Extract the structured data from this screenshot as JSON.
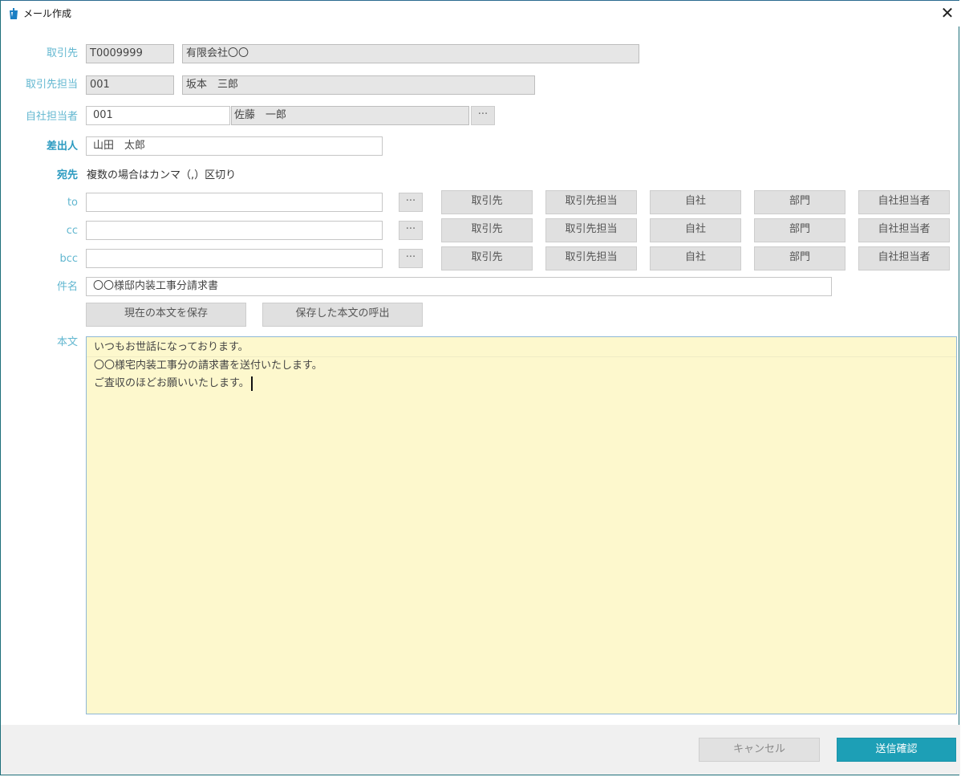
{
  "window": {
    "title": "メール作成",
    "close_glyph": "✕",
    "icon": "document-app-icon"
  },
  "customer": {
    "label": "取引先",
    "code": "T0009999",
    "name": "有限会社〇〇"
  },
  "customer_contact": {
    "label": "取引先担当",
    "code": "001",
    "name": "坂本　三郎"
  },
  "company_staff": {
    "label": "自社担当者",
    "code": "001",
    "name": "佐藤　一郎",
    "lookup_label": "···"
  },
  "sender": {
    "label": "差出人",
    "value": "山田　太郎"
  },
  "recipients": {
    "label": "宛先",
    "hint": "複数の場合はカンマ（,）区切り",
    "rows": [
      {
        "label": "to",
        "value": ""
      },
      {
        "label": "cc",
        "value": ""
      },
      {
        "label": "bcc",
        "value": ""
      }
    ],
    "lookup_label": "···",
    "buttons": [
      "取引先",
      "取引先担当",
      "自社",
      "部門",
      "自社担当者"
    ]
  },
  "subject": {
    "label": "件名",
    "value": "〇〇様邸内装工事分請求書"
  },
  "body_actions": {
    "save": "現在の本文を保存",
    "recall": "保存した本文の呼出"
  },
  "body": {
    "label": "本文",
    "lines": [
      "いつもお世話になっております。",
      "〇〇様宅内装工事分の請求書を送付いたします。",
      "ご査収のほどお願いいたします。"
    ]
  },
  "footer": {
    "cancel": "キャンセル",
    "send": "送信確認"
  },
  "colors": {
    "accent": "#1d9fb6",
    "label": "#62b7d0",
    "body_bg": "#fdf8cd"
  }
}
